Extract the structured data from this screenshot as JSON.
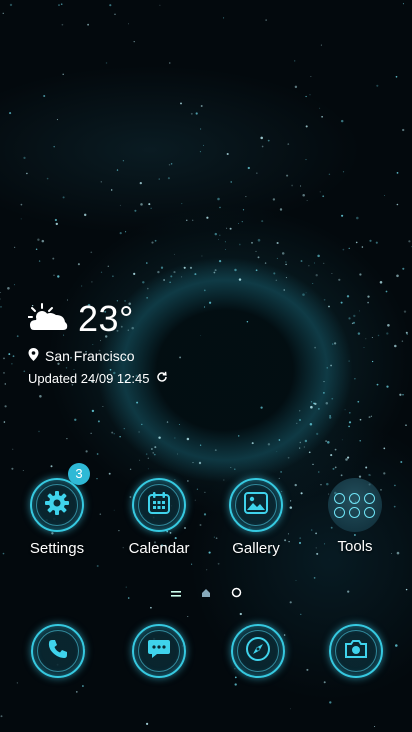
{
  "weather": {
    "temperature": "23°",
    "location": "San Francisco",
    "updated": "Updated 24/09 12:45"
  },
  "apps": [
    {
      "label": "Settings",
      "icon": "gear-icon",
      "badge": "3"
    },
    {
      "label": "Calendar",
      "icon": "calendar-icon"
    },
    {
      "label": "Gallery",
      "icon": "image-icon"
    },
    {
      "label": "Tools",
      "icon": "folder-icon"
    }
  ],
  "dock": [
    {
      "icon": "phone-icon"
    },
    {
      "icon": "message-icon"
    },
    {
      "icon": "compass-icon"
    },
    {
      "icon": "camera-icon"
    }
  ],
  "colors": {
    "accent": "#36c9e0",
    "badge": "#2fb9d6"
  }
}
